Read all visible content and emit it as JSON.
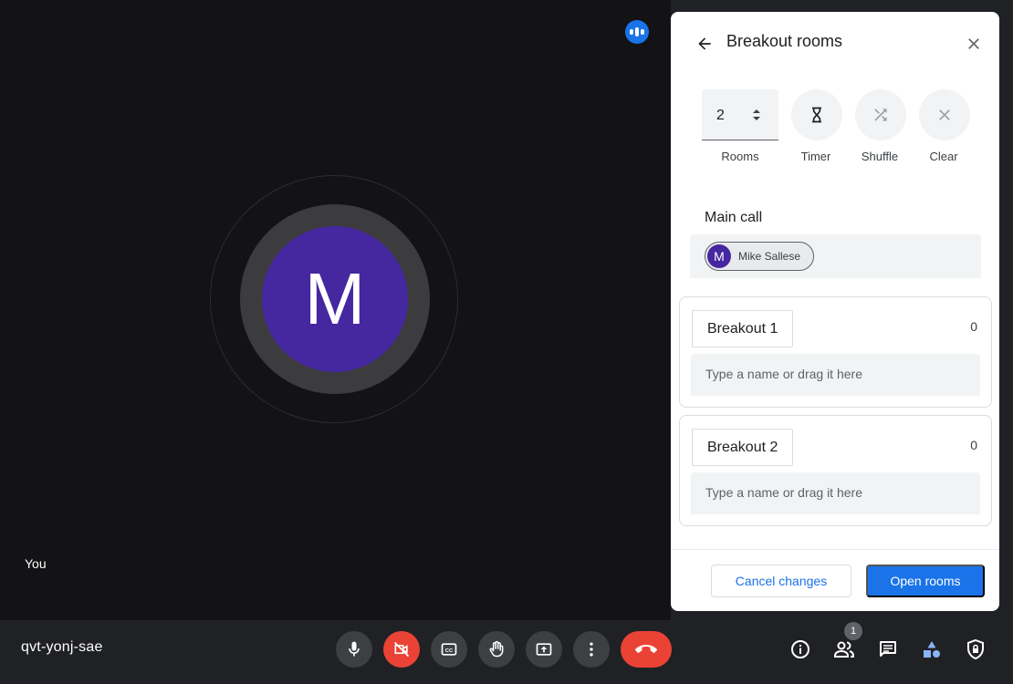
{
  "meeting": {
    "code": "qvt-yonj-sae",
    "self_label": "You",
    "avatar_initial": "M",
    "participant_count": "1"
  },
  "controls": [
    {
      "name": "microphone-button",
      "icon": "mic-icon"
    },
    {
      "name": "camera-off-button",
      "icon": "videocam-off-icon",
      "color": "#ea4335"
    },
    {
      "name": "captions-button",
      "icon": "closed-caption-icon"
    },
    {
      "name": "raise-hand-button",
      "icon": "hand-icon"
    },
    {
      "name": "present-button",
      "icon": "present-screen-icon"
    },
    {
      "name": "more-options-button",
      "icon": "more-vert-icon"
    },
    {
      "name": "end-call-button",
      "icon": "call-end-icon",
      "color": "#ea4335"
    }
  ],
  "right_actions": [
    "info-icon",
    "people-icon",
    "chat-icon",
    "activities-icon",
    "host-controls-icon"
  ],
  "breakout": {
    "title": "Breakout rooms",
    "rooms_count": "2",
    "rooms_label": "Rooms",
    "timer_label": "Timer",
    "shuffle_label": "Shuffle",
    "clear_label": "Clear",
    "main_call_title": "Main call",
    "main_call_participants": [
      {
        "initial": "M",
        "name": "Mike Sallese"
      }
    ],
    "rooms": [
      {
        "name": "Breakout 1",
        "count": "0",
        "placeholder": "Type a name or drag it here"
      },
      {
        "name": "Breakout 2",
        "count": "0",
        "placeholder": "Type a name or drag it here"
      }
    ],
    "cancel_label": "Cancel changes",
    "open_label": "Open rooms"
  },
  "colors": {
    "accent": "#1a73e8",
    "danger": "#ea4335",
    "avatar": "#4527a0",
    "stage_bg": "#131316"
  }
}
